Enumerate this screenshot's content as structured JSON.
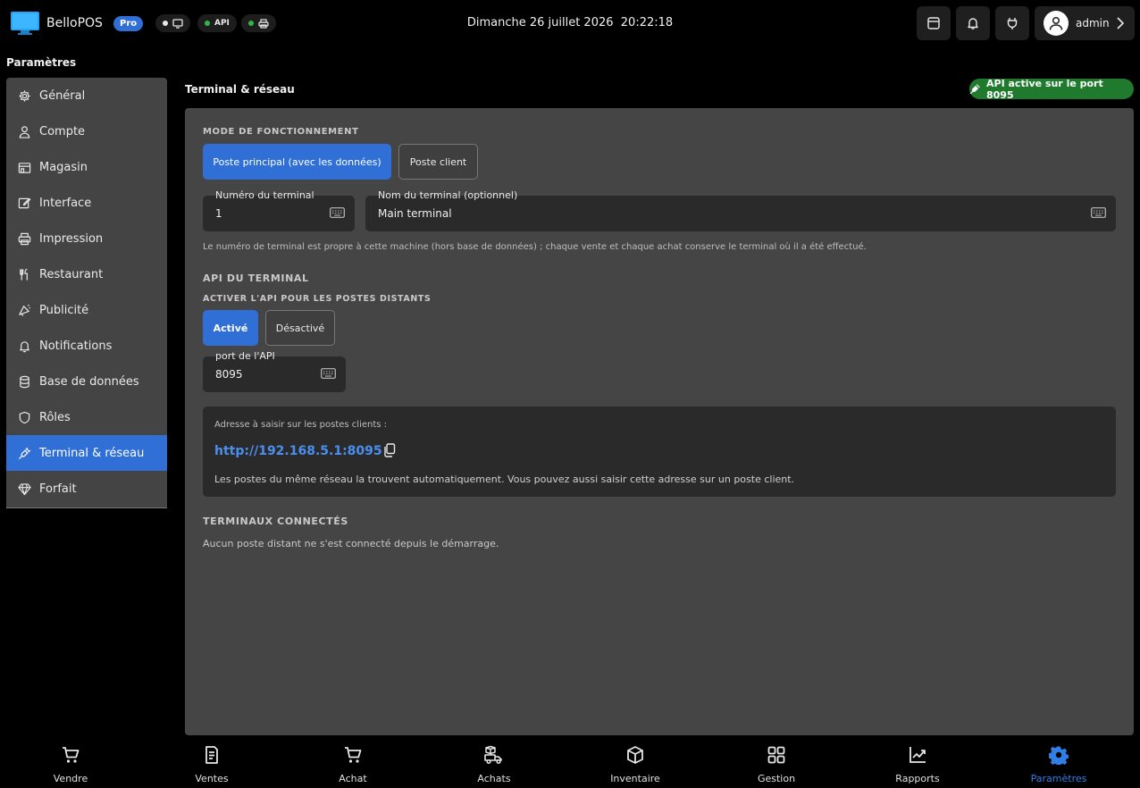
{
  "header": {
    "app_name": "BelloPOS",
    "badge": "Pro",
    "status": [
      {
        "label": "",
        "dot_color": "#e8e8e8",
        "icon": "monitor-icon"
      },
      {
        "label": "API",
        "dot_color": "#2fb84a",
        "icon": ""
      },
      {
        "label": "",
        "dot_color": "#2fb84a",
        "icon": "printer-icon"
      }
    ],
    "datetime": "Dimanche 26 juillet 2026  20:22:18",
    "user_name": "admin"
  },
  "sidebar": {
    "title": "Paramètres",
    "items": [
      {
        "label": "Général",
        "icon": "gear-icon"
      },
      {
        "label": "Compte",
        "icon": "user-icon"
      },
      {
        "label": "Magasin",
        "icon": "store-icon"
      },
      {
        "label": "Interface",
        "icon": "edit-icon"
      },
      {
        "label": "Impression",
        "icon": "printer-icon"
      },
      {
        "label": "Restaurant",
        "icon": "utensils-icon"
      },
      {
        "label": "Publicité",
        "icon": "megaphone-icon"
      },
      {
        "label": "Notifications",
        "icon": "bell-icon"
      },
      {
        "label": "Base de données",
        "icon": "database-icon"
      },
      {
        "label": "Rôles",
        "icon": "shield-icon"
      },
      {
        "label": "Terminal & réseau",
        "icon": "plug-icon",
        "active": true
      },
      {
        "label": "Forfait",
        "icon": "diamond-icon"
      }
    ]
  },
  "main": {
    "title": "Terminal & réseau",
    "api_badge": "API active sur le port 8095",
    "mode_label": "MODE DE FONCTIONNEMENT",
    "mode_primary": "Poste principal (avec les données)",
    "mode_client": "Poste client",
    "terminal_number_label": "Numéro du terminal",
    "terminal_number_value": "1",
    "terminal_name_label": "Nom du terminal (optionnel)",
    "terminal_name_value": "Main terminal",
    "terminal_help": "Le numéro de terminal est propre à cette machine (hors base de données) ; chaque vente et chaque achat conserve le terminal où il a été effectué.",
    "api_section": "API DU TERMINAL",
    "api_enable_label": "ACTIVER L'API POUR LES POSTES DISTANTS",
    "api_on": "Activé",
    "api_off": "Désactivé",
    "port_label": "port de l'API",
    "port_value": "8095",
    "address_label": "Adresse à saisir sur les postes clients :",
    "address_url": "http://192.168.5.1:8095",
    "address_note": "Les postes du même réseau la trouvent automatiquement. Vous pouvez aussi saisir cette adresse sur un poste client.",
    "connected_label": "TERMINAUX CONNECTÉS",
    "connected_empty": "Aucun poste distant ne s'est connecté depuis le démarrage."
  },
  "bottom_nav": [
    {
      "label": "Vendre",
      "icon": "cart-icon"
    },
    {
      "label": "Ventes",
      "icon": "receipt-icon"
    },
    {
      "label": "Achat",
      "icon": "cart-icon"
    },
    {
      "label": "Achats",
      "icon": "delivery-icon"
    },
    {
      "label": "Inventaire",
      "icon": "box-icon"
    },
    {
      "label": "Gestion",
      "icon": "grid-icon"
    },
    {
      "label": "Rapports",
      "icon": "chart-icon"
    },
    {
      "label": "Paramètres",
      "icon": "gear-icon",
      "active": true
    }
  ],
  "colors": {
    "accent": "#2f6fd6",
    "success": "#1f7a2e",
    "link": "#4a8ff0"
  }
}
